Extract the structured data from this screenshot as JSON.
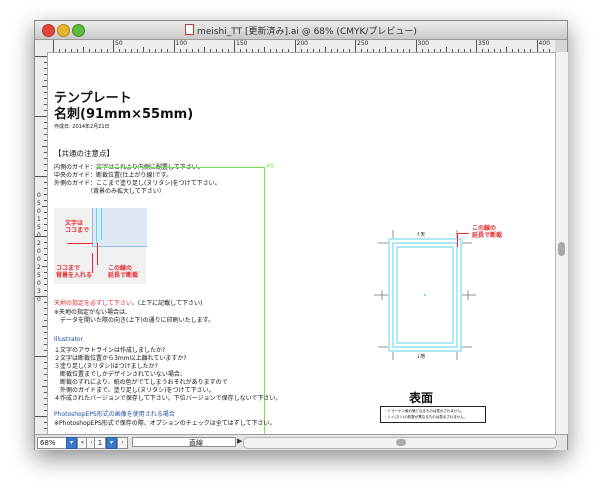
{
  "window": {
    "title": "meishi_TT [更新済み].ai @ 68% (CMYK/プレビュー)"
  },
  "ruler": {
    "top_labels": [
      "50",
      "100",
      "150",
      "200",
      "250",
      "300",
      "350",
      "400"
    ],
    "left_labels": [
      "0",
      "5",
      "0",
      "1",
      "5",
      "0",
      "2",
      "0",
      "0",
      "2",
      "5",
      "0",
      "3",
      "0"
    ]
  },
  "document": {
    "heading": "テンプレート",
    "subheading": "名刺(91mm×55mm)",
    "created": "作成日: 2014年2月21日",
    "common_notes_title": "【共通の注意点】",
    "guide_lines": [
      "内側のガイド：文字はこれより内側に配置して下さい。",
      "中央のガイド：断裁位置(仕上がり線)です。",
      "外側のガイド：ここまで塗り足し(ヌリタシ)をつけて下さい。",
      "　　　　　　（背景のみ拡大して下さい）"
    ],
    "diagram_labels": {
      "text_here": "文字は\nココまで",
      "bg_here": "ココまで\n背景を入れる",
      "extend": "この線の\n延長で断裁"
    },
    "orientation_note": "天地の指定を必ずして下さい。",
    "orientation_note_suffix": "(上下に記載して下さい)",
    "orientation_lines": [
      "※天地の指定がない場合は、",
      "　データを開いた際の向き(上下)の通りに印刷いたします。"
    ],
    "illustrator_title": "Illustrator",
    "illustrator_items": [
      "１文字のアウトラインは作成しましたか?",
      "２文字は断裁位置から3mm以上離れていますか?",
      "３塗り足し(ヌリタシ)はつけましたか?",
      "　断裁位置までしかデザインされていない場合、",
      "　断裁のずれにより、紙の色がでてしまうおそれがありますので",
      "　外側のガイドまで、塗り足し(ヌリタシ)をつけて下さい。",
      "４作成されたバージョンで保存して下さい。下位バージョンで保存しないで下さい。"
    ],
    "photoshop_title": "PhotoshopEPS形式の画像を使用される場合",
    "photoshop_line": "※PhotoshopEPS形式で保存の際、オプションのチェックは全てはずして下さい。",
    "artboard_label_small": "表面",
    "card": {
      "top_mark": "↑天",
      "bottom_mark": "↓地",
      "cut_note": "この線の\n延長で断裁",
      "face_label": "表面",
      "warning_lines": [
        "・ドラーゲン線の値となるものは表示されません。",
        "・レイ(ヌリ)の枚数が異なるものは表示されません。"
      ]
    }
  },
  "statusbar": {
    "zoom": "68%",
    "page": "1",
    "mode": "直線"
  },
  "colors": {
    "guide_green": "#7be04d",
    "guide_cyan": "#5fd3f0",
    "note_red": "#e8272c",
    "heading_blue": "#1f4fa3"
  }
}
